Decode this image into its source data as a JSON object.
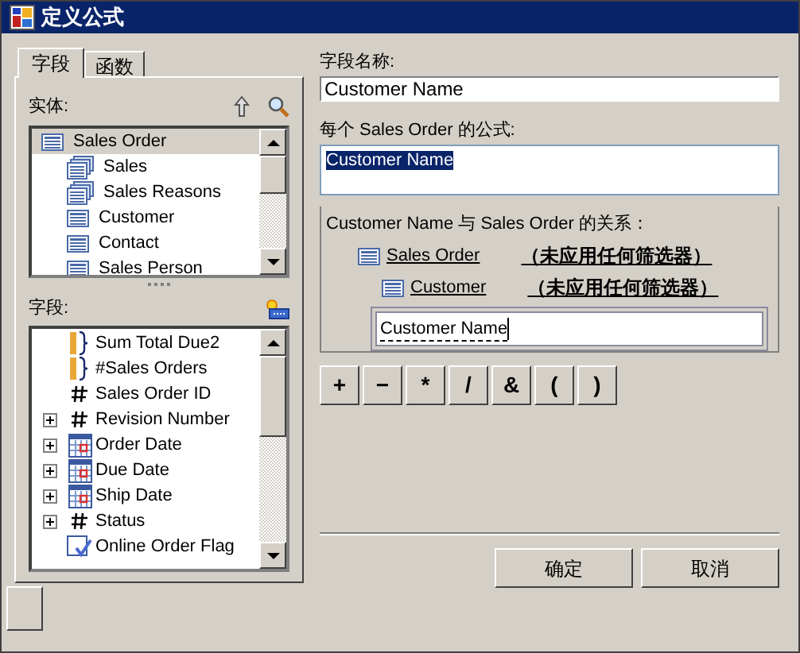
{
  "window": {
    "title": "定义公式"
  },
  "tabs": [
    {
      "label": "字段",
      "selected": true
    },
    {
      "label": "函数",
      "selected": false
    }
  ],
  "entities": {
    "label": "实体:",
    "items": [
      {
        "name": "Sales Order",
        "kind": "single",
        "selected": true,
        "indent": false
      },
      {
        "name": "Sales",
        "kind": "multi",
        "selected": false,
        "indent": true
      },
      {
        "name": "Sales Reasons",
        "kind": "multi",
        "selected": false,
        "indent": true
      },
      {
        "name": "Customer",
        "kind": "single",
        "selected": false,
        "indent": true
      },
      {
        "name": "Contact",
        "kind": "single",
        "selected": false,
        "indent": true
      },
      {
        "name": "Sales Person",
        "kind": "single",
        "selected": false,
        "indent": true
      }
    ]
  },
  "fields": {
    "label": "字段:",
    "items": [
      {
        "name": "Sum Total Due2",
        "kind": "aggregate",
        "expandable": false
      },
      {
        "name": "#Sales Orders",
        "kind": "aggregate",
        "expandable": false
      },
      {
        "name": "Sales Order ID",
        "kind": "number",
        "expandable": false
      },
      {
        "name": "Revision Number",
        "kind": "number",
        "expandable": true
      },
      {
        "name": "Order Date",
        "kind": "date",
        "expandable": true
      },
      {
        "name": "Due Date",
        "kind": "date",
        "expandable": true
      },
      {
        "name": "Ship Date",
        "kind": "date",
        "expandable": true
      },
      {
        "name": "Status",
        "kind": "number",
        "expandable": true
      },
      {
        "name": "Online Order Flag",
        "kind": "boolean",
        "expandable": false
      }
    ]
  },
  "field_name": {
    "label": "字段名称:",
    "value": "Customer Name"
  },
  "formula": {
    "label": "每个 Sales Order 的公式:",
    "value": "Customer Name"
  },
  "relationship": {
    "label": "Customer Name 与 Sales Order 的关系：",
    "path": [
      {
        "entity": "Sales Order",
        "filter": "（未应用任何筛选器）"
      },
      {
        "entity": "Customer",
        "filter": "（未应用任何筛选器）"
      }
    ],
    "field": "Customer Name"
  },
  "operators": [
    "+",
    "−",
    "*",
    "/",
    "&",
    "(",
    ")"
  ],
  "buttons": [
    "确定",
    "取消"
  ]
}
